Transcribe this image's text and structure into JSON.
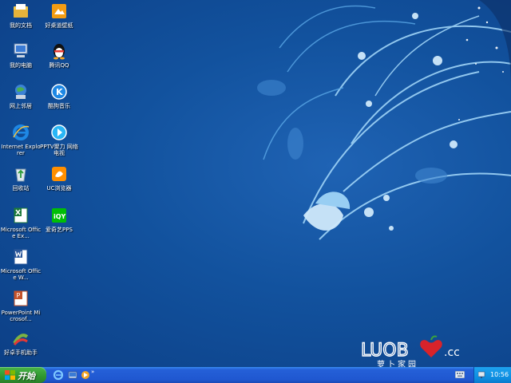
{
  "desktop": {
    "icons": [
      {
        "label": "我的文档",
        "icon": "my-documents-icon"
      },
      {
        "label": "好桌道壁纸",
        "icon": "wallpaper-app-icon"
      },
      {
        "label": "我的电脑",
        "icon": "my-computer-icon"
      },
      {
        "label": "腾讯QQ",
        "icon": "qq-penguin-icon"
      },
      {
        "label": "网上邻居",
        "icon": "network-places-icon"
      },
      {
        "label": "酷狗音乐",
        "icon": "kugou-music-icon"
      },
      {
        "label": "Internet Explorer",
        "icon": "internet-explorer-icon"
      },
      {
        "label": "PPTV聚力 网络电视",
        "icon": "pptv-icon"
      },
      {
        "label": "回收站",
        "icon": "recycle-bin-icon"
      },
      {
        "label": "UC浏览器",
        "icon": "uc-browser-icon"
      },
      {
        "label": "Microsoft Office Ex...",
        "icon": "excel-icon"
      },
      {
        "label": "爱奇艺PPS",
        "icon": "iqiyi-icon"
      },
      {
        "label": "Microsoft Office W...",
        "icon": "word-icon"
      },
      {
        "label": "PowerPoint Microsof...",
        "icon": "powerpoint-icon"
      },
      {
        "label": "好卓手机助手",
        "icon": "phone-assistant-icon"
      }
    ]
  },
  "wallpaper": {
    "logo_text": "LUOB",
    "logo_suffix": ".cc",
    "logo_subtitle": "萝卜家园"
  },
  "taskbar": {
    "start_label": "开始",
    "chevron": "»",
    "clock": "10:56",
    "quick_launch": [
      "ie-icon",
      "show-desktop-icon",
      "media-icon"
    ]
  },
  "colors": {
    "desktop_bg": "#12529e",
    "taskbar": "#2560d8",
    "start_button": "#2f962f",
    "tray": "#0d8de0",
    "logo_red": "#d8232a"
  }
}
